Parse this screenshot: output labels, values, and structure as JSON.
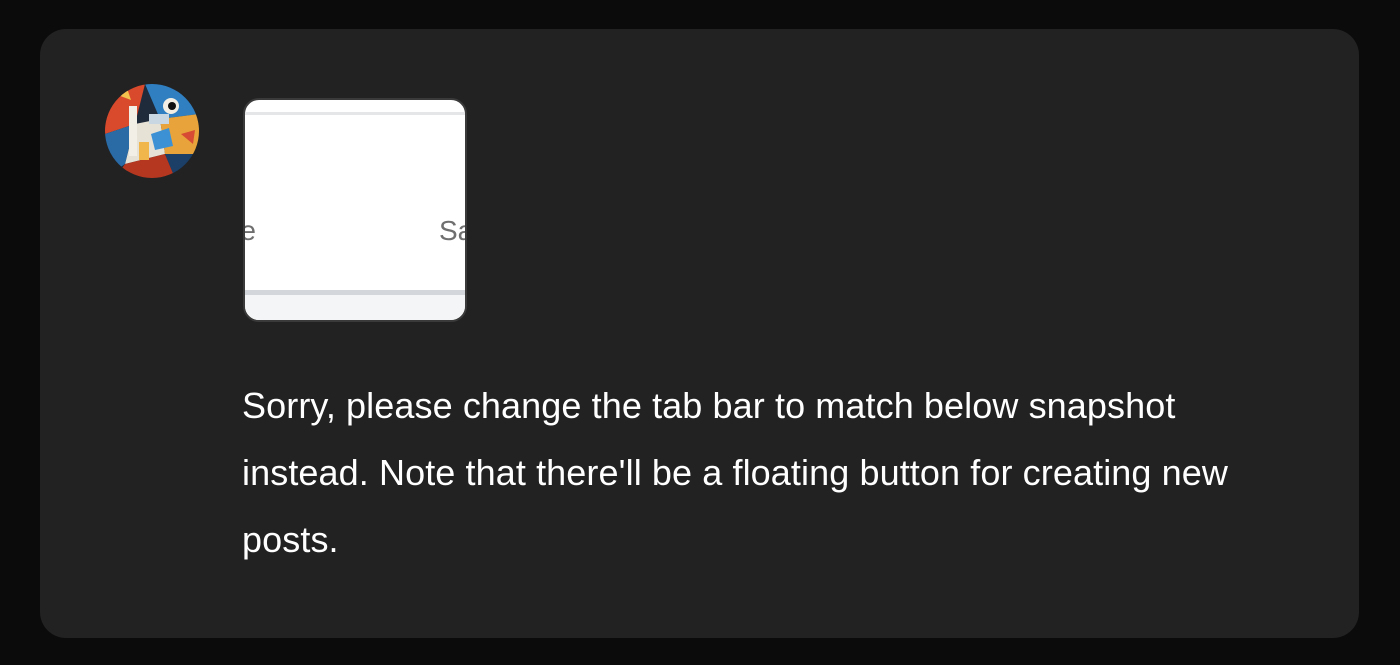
{
  "attachment": {
    "left_label": "re",
    "right_label": "Sa"
  },
  "message": {
    "text": "Sorry, please change the tab bar to match below snapshot instead. Note that there'll be a floating button for creating new posts."
  },
  "colors": {
    "background": "#0b0b0b",
    "card": "#222222",
    "text": "#ffffff"
  }
}
